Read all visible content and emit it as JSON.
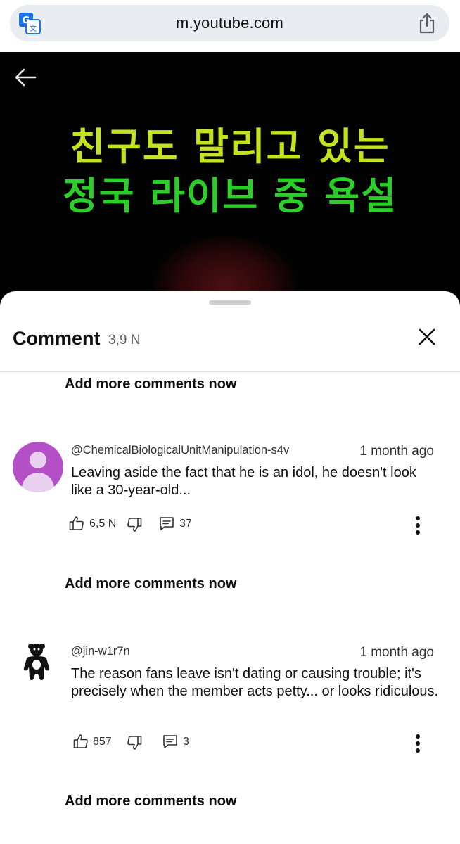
{
  "browser": {
    "url": "m.youtube.com",
    "left_icon": "translate-icon",
    "right_icon": "share-icon"
  },
  "video": {
    "back_icon": "back-arrow-icon",
    "title_line1": "친구도 말리고 있는",
    "title_line2": "정국 라이브 중 욕설",
    "colors": {
      "line1": "#c6e21f",
      "line2": "#2ccf2a",
      "background": "#020202"
    }
  },
  "comments_panel": {
    "title": "Comment",
    "count": "3,9 N",
    "close_icon": "close-icon",
    "add_more_label_1": "Add more comments now",
    "add_more_label_2": "Add more comments now",
    "add_more_label_3": "Add more comments now",
    "comments": [
      {
        "author": "@ChemicalBiologicalUnitManipulation-s4v",
        "time": "1 month ago",
        "text": "Leaving aside the fact that he is an idol, he doesn't look like a 30-year-old...",
        "likes": "6,5 N",
        "replies": "37",
        "avatar": "purple-default-avatar",
        "avatar_color": "#b44fc8"
      },
      {
        "author": "@jin-w1r7n",
        "time": "1 month ago",
        "text": "The reason fans leave isn't dating or causing trouble; it's precisely when the member acts petty... or looks ridiculous.",
        "likes": "857",
        "replies": "3",
        "avatar": "bear-avatar"
      }
    ]
  }
}
